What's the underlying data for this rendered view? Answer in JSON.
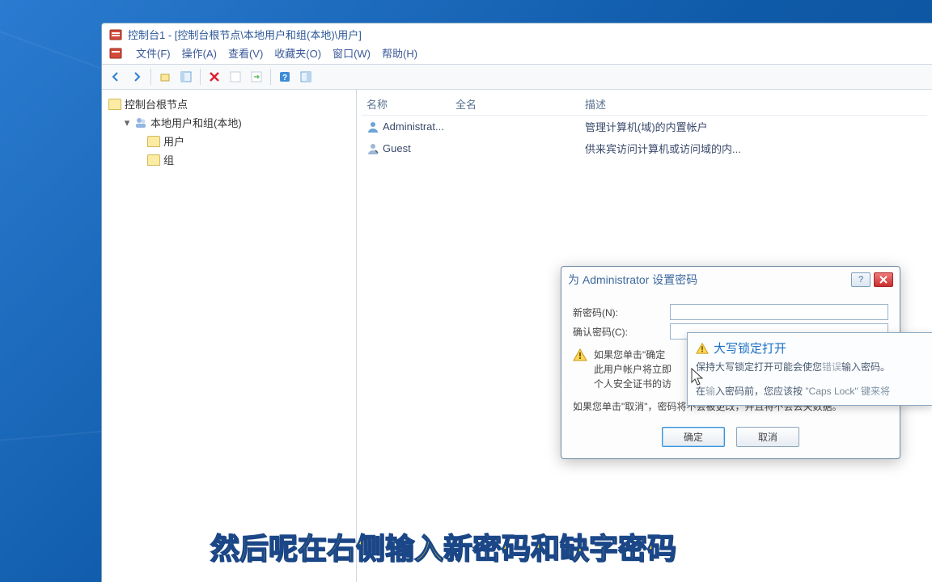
{
  "window": {
    "title": "控制台1 - [控制台根节点\\本地用户和组(本地)\\用户]"
  },
  "menu": {
    "file": "文件(F)",
    "action": "操作(A)",
    "view": "查看(V)",
    "favorites": "收藏夹(O)",
    "window": "窗口(W)",
    "help": "帮助(H)"
  },
  "toolbar_icons": {
    "back": "back-icon",
    "forward": "forward-icon",
    "up": "up-icon",
    "window": "window-icon",
    "delete": "delete-icon",
    "blank": "blank-icon",
    "goto": "goto-icon",
    "help": "help-icon",
    "panel": "panel-icon"
  },
  "tree": {
    "root": "控制台根节点",
    "group": "本地用户和组(本地)",
    "users": "用户",
    "groups": "组"
  },
  "list": {
    "header": {
      "name": "名称",
      "fullname": "全名",
      "desc": "描述"
    },
    "rows": [
      {
        "name": "Administrat...",
        "full": "",
        "desc": "管理计算机(域)的内置帐户"
      },
      {
        "name": "Guest",
        "full": "",
        "desc": "供来宾访问计算机或访问域的内..."
      }
    ]
  },
  "dialog": {
    "title": "为 Administrator 设置密码",
    "new_password_label": "新密码(N):",
    "confirm_password_label": "确认密码(C):",
    "warning_line1": "如果您单击\"确定",
    "warning_line2": "此用户帐户将立即",
    "warning_line3": "个人安全证书的访",
    "note": "如果您单击\"取消\"，密码将不会被更改，并且将不会丢失数据。",
    "ok": "确定",
    "cancel": "取消"
  },
  "tooltip": {
    "title": "大写锁定打开",
    "line1_a": "保持大写锁定打开可能会使您",
    "line1_b": "错误",
    "line1_c": "输入密码。",
    "line2_a": "在",
    "line2_b": "输",
    "line2_c": "入密码前，您应该按",
    "line2_key": "\"Caps Lock\"",
    "line2_d": "键来将"
  },
  "subtitle": "然后呢在右侧输入新密码和缺字密码"
}
